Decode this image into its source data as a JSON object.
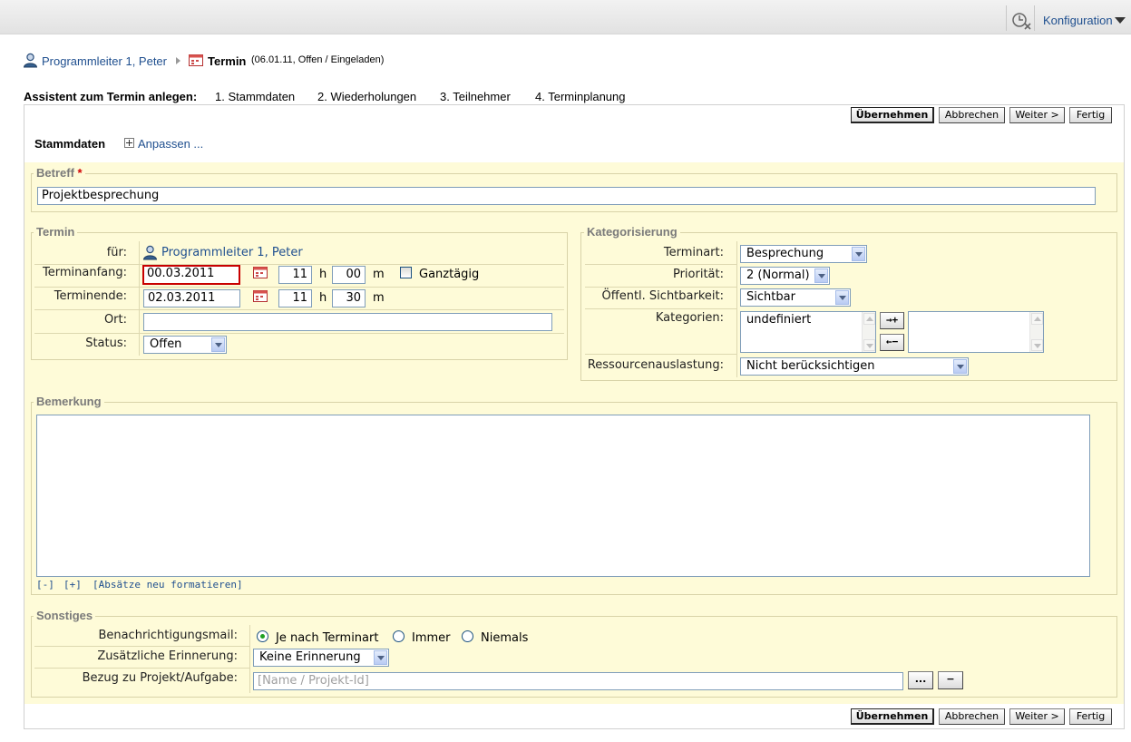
{
  "topbar": {
    "config_label": "Konfiguration",
    "clock_icon": "clock-cancel-icon"
  },
  "breadcrumb": {
    "user": "Programmleiter 1, Peter",
    "termin": "Termin",
    "status": "(06.01.11, Offen / Eingeladen)"
  },
  "wizard": {
    "title": "Assistent zum Termin anlegen:",
    "steps": [
      "1. Stammdaten",
      "2. Wiederholungen",
      "3. Teilnehmer",
      "4. Terminplanung"
    ]
  },
  "buttons": {
    "apply": "Übernehmen",
    "cancel": "Abbrechen",
    "next": "Weiter >",
    "finish": "Fertig"
  },
  "section": {
    "title": "Stammdaten",
    "customize": "Anpassen ..."
  },
  "betreff": {
    "legend": "Betreff",
    "required_mark": "*",
    "value": "Projektbesprechung"
  },
  "termin": {
    "legend": "Termin",
    "fuer_label": "für:",
    "fuer_value": "Programmleiter 1, Peter",
    "start_label": "Terminanfang:",
    "start_date": "00.03.2011",
    "start_hour": "11",
    "start_min": "00",
    "end_label": "Terminende:",
    "end_date": "02.03.2011",
    "end_hour": "11",
    "end_min": "30",
    "hour_unit": "h",
    "min_unit": "m",
    "allday_label": "Ganztägig",
    "allday_checked": false,
    "ort_label": "Ort:",
    "ort_value": "",
    "status_label": "Status:",
    "status_value": "Offen"
  },
  "kategorisierung": {
    "legend": "Kategorisierung",
    "type_label": "Terminart:",
    "type_value": "Besprechung",
    "prio_label": "Priorität:",
    "prio_value": "2 (Normal)",
    "vis_label": "Öffentl. Sichtbarkeit:",
    "vis_value": "Sichtbar",
    "cat_label": "Kategorien:",
    "cat_available": [
      "undefiniert"
    ],
    "cat_selected": [],
    "add_btn": "→+",
    "remove_btn": "←−",
    "res_label": "Ressourcenauslastung:",
    "res_value": "Nicht berücksichtigen"
  },
  "bemerkung": {
    "legend": "Bemerkung",
    "value": "",
    "collapse": "[-]",
    "expand": "[+]",
    "reformat": "[Absätze neu formatieren]"
  },
  "sonstiges": {
    "legend": "Sonstiges",
    "mail_label": "Benachrichtigungsmail:",
    "mail_options": [
      "Je nach Terminart",
      "Immer",
      "Niemals"
    ],
    "mail_selected": 0,
    "reminder_label": "Zusätzliche Erinnerung:",
    "reminder_value": "Keine Erinnerung",
    "project_label": "Bezug zu Projekt/Aufgabe:",
    "project_placeholder": "[Name / Projekt-Id]",
    "browse_btn": "...",
    "clear_btn": "−"
  },
  "colors": {
    "panel_bg": "#fefbd8",
    "link": "#1f4f8f",
    "error_border": "#c80000",
    "required": "#d20000"
  }
}
